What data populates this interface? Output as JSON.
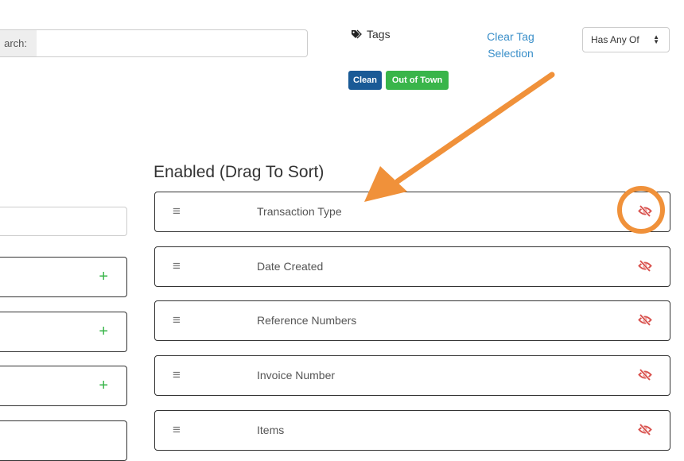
{
  "search": {
    "label": "arch:",
    "value": ""
  },
  "tags": {
    "heading": "Tags",
    "clear_label": "Clear Tag Selection",
    "match_mode": "Has Any Of",
    "badges": [
      {
        "label": "Clean",
        "color": "#1a5a96"
      },
      {
        "label": "Out of Town",
        "color": "#39b54a"
      }
    ]
  },
  "enabled": {
    "title": "Enabled (Drag To Sort)",
    "items": [
      {
        "label": "Transaction Type"
      },
      {
        "label": "Date Created"
      },
      {
        "label": "Reference Numbers"
      },
      {
        "label": "Invoice Number"
      },
      {
        "label": "Items"
      }
    ]
  },
  "icons": {
    "tag": "tag-icon",
    "drag_handle": "drag-handle-icon",
    "hide": "eye-slash-icon",
    "add": "plus-icon",
    "sort": "sort-caret-icon"
  },
  "colors": {
    "link": "#3a8fc9",
    "hide_icon": "#d9534f",
    "add_icon": "#39b54a",
    "annotation": "#f0913a"
  }
}
